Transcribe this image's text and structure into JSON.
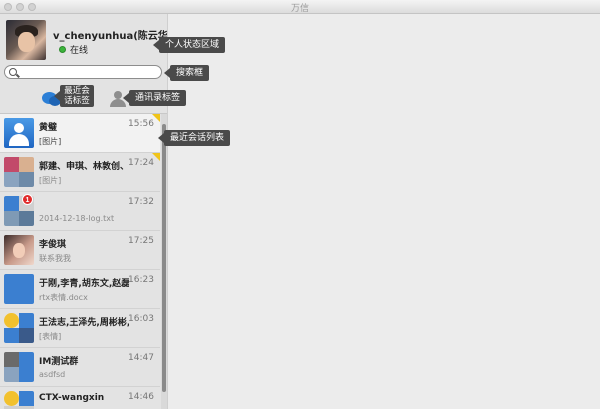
{
  "window": {
    "title": "万信"
  },
  "profile": {
    "username": "v_chenyunhua(陈云华)",
    "status": "在线",
    "status_color": "#3cb43c"
  },
  "search": {
    "value": "",
    "placeholder": ""
  },
  "tabs": [
    {
      "name": "recent-chats",
      "icon": "chat-bubbles-icon",
      "active": true
    },
    {
      "name": "contacts",
      "icon": "person-icon",
      "active": false
    }
  ],
  "conversations": [
    {
      "name": "黄璧",
      "time": "15:56",
      "message": "[图片]",
      "flag": true,
      "selected": true,
      "avatar": "default-user-icon"
    },
    {
      "name": "郭建、申琪、林敦创、张",
      "time": "17:24",
      "message": "[图片]",
      "flag": true,
      "avatar": "group-avatar"
    },
    {
      "name": "",
      "time": "17:32",
      "message": "2014-12-18-log.txt",
      "badge": "1",
      "avatar": "group-avatar"
    },
    {
      "name": "李俊琪",
      "time": "17:25",
      "message": "联系我我",
      "avatar": "photo-avatar"
    },
    {
      "name": "于刚,李青,胡东文,赵磊,",
      "time": "16:23",
      "message": "rtx表情.docx",
      "avatar": "group-avatar"
    },
    {
      "name": "王法志,王泽先,周彬彬,邢",
      "time": "16:03",
      "message": "[表情]",
      "avatar": "group-avatar"
    },
    {
      "name": "IM测试群",
      "time": "14:47",
      "message": "asdfsd",
      "avatar": "group-avatar"
    },
    {
      "name": "CTX-wangxin",
      "time": "14:46",
      "message": "fd",
      "avatar": "group-avatar"
    }
  ],
  "annotations": {
    "profile_area": "个人状态区域",
    "search_box": "搜索框",
    "recent_tab": "最近会话标签",
    "contacts_tab": "通讯录标签",
    "chat_list": "最近会话列表"
  },
  "colors": {
    "accent": "#2c7fd6",
    "badge": "#e02b2b",
    "flag": "#f0c419",
    "callout": "#4a4a4a"
  }
}
